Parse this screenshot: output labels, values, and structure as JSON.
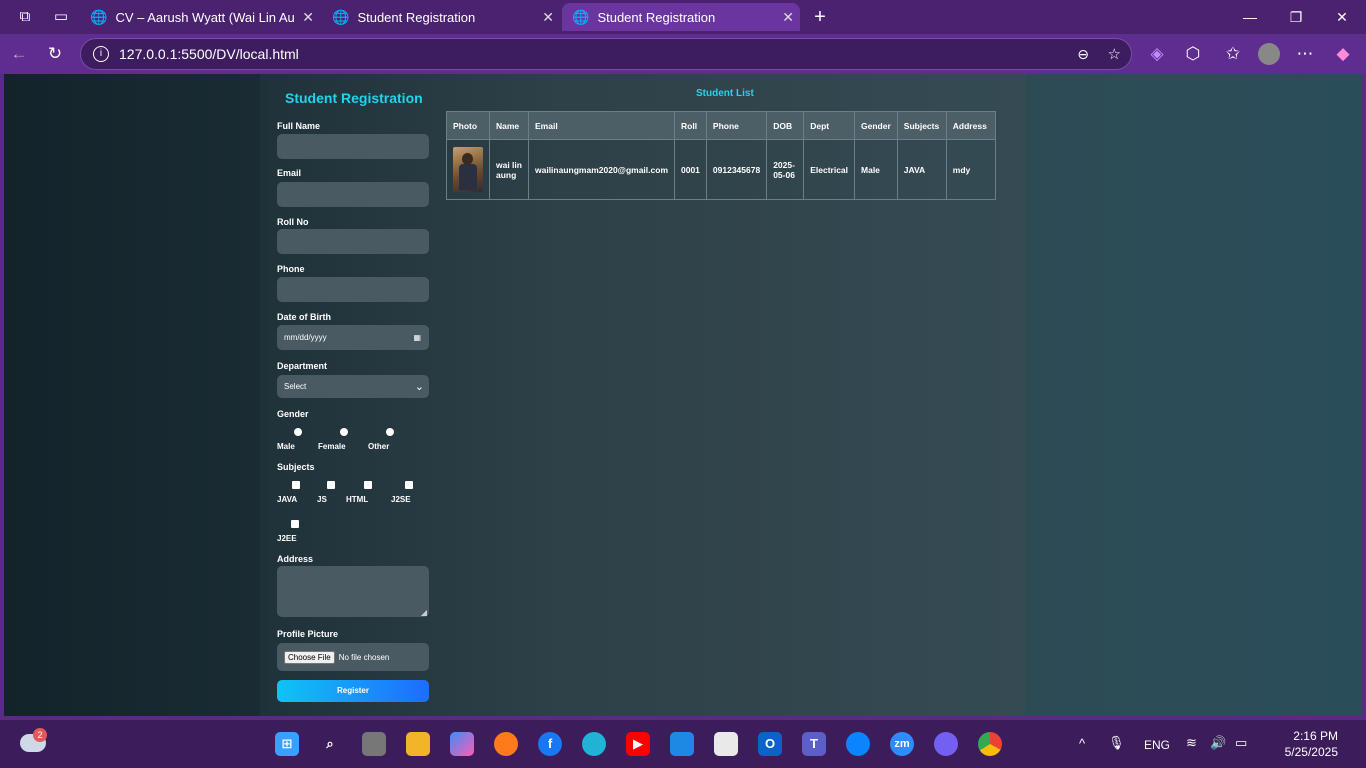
{
  "browser": {
    "tabs": [
      {
        "title": "CV – Aarush Wyatt (Wai Lin Aung",
        "active": false
      },
      {
        "title": "Student Registration",
        "active": false
      },
      {
        "title": "Student Registration",
        "active": true
      }
    ],
    "url": "127.0.0.1:5500/DV/local.html"
  },
  "form": {
    "title": "Student Registration",
    "full_name_label": "Full Name",
    "email_label": "Email",
    "roll_label": "Roll No",
    "phone_label": "Phone",
    "dob_label": "Date of Birth",
    "dob_placeholder": "mm/dd/yyyy",
    "dept_label": "Department",
    "dept_selected": "Select",
    "gender_label": "Gender",
    "genders": [
      "Male",
      "Female",
      "Other"
    ],
    "subjects_label": "Subjects",
    "subjects": [
      "JAVA",
      "JS",
      "HTML",
      "J2SE",
      "J2EE"
    ],
    "address_label": "Address",
    "picture_label": "Profile Picture",
    "choose_file": "Choose File",
    "no_file": "No file chosen",
    "register": "Register"
  },
  "list": {
    "title": "Student List",
    "headers": [
      "Photo",
      "Name",
      "Email",
      "Roll",
      "Phone",
      "DOB",
      "Dept",
      "Gender",
      "Subjects",
      "Address"
    ],
    "rows": [
      {
        "name": "wai lin aung",
        "email": "wailinaungmam2020@gmail.com",
        "roll": "0001",
        "phone": "0912345678",
        "dob": "2025-05-06",
        "dept": "Electrical",
        "gender": "Male",
        "subjects": "JAVA",
        "address": "mdy"
      }
    ]
  },
  "taskbar": {
    "weather_badge": "2",
    "lang": "ENG",
    "time": "2:16 PM",
    "date": "5/25/2025"
  },
  "colors": {
    "accent": "#22d3ee",
    "browser": "#5e2d8f",
    "register_start": "#0fc4f4",
    "register_end": "#1f6bff"
  }
}
